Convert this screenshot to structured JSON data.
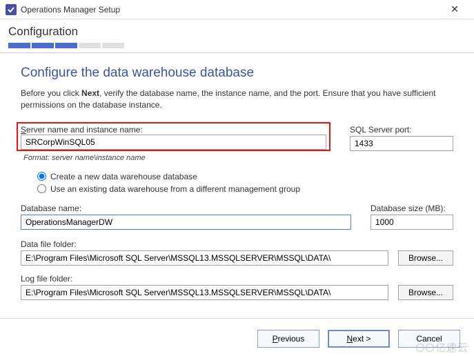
{
  "titlebar": {
    "title": "Operations Manager Setup"
  },
  "header": {
    "band_title": "Configuration",
    "progress_total": 5,
    "progress_done": 3
  },
  "page": {
    "title": "Configure the data warehouse database",
    "description_pre": "Before you click ",
    "description_bold": "Next",
    "description_post": ", verify the database name, the instance name, and the port. Ensure that you have sufficient permissions on the database instance."
  },
  "fields": {
    "server_label_pre": "S",
    "server_label_post": "erver name and instance name:",
    "server_value": "SRCorpWinSQL05",
    "format_hint": "Format: server name\\instance name",
    "port_label": "SQL Server port:",
    "port_value": "1433",
    "radio_create": "Create a new data warehouse database",
    "radio_existing": "Use an existing data warehouse from a different management group",
    "db_name_label": "Database name:",
    "db_name_value": "OperationsManagerDW",
    "db_size_label": "Database size (MB):",
    "db_size_value": "1000",
    "data_folder_label": "Data file folder:",
    "data_folder_value": "E:\\Program Files\\Microsoft SQL Server\\MSSQL13.MSSQLSERVER\\MSSQL\\DATA\\",
    "log_folder_label": "Log file folder:",
    "log_folder_value": "E:\\Program Files\\Microsoft SQL Server\\MSSQL13.MSSQLSERVER\\MSSQL\\DATA\\",
    "browse_label": "Browse..."
  },
  "footer": {
    "previous": "Previous",
    "next": "Next >",
    "cancel": "Cancel"
  },
  "watermark": "亿速云"
}
